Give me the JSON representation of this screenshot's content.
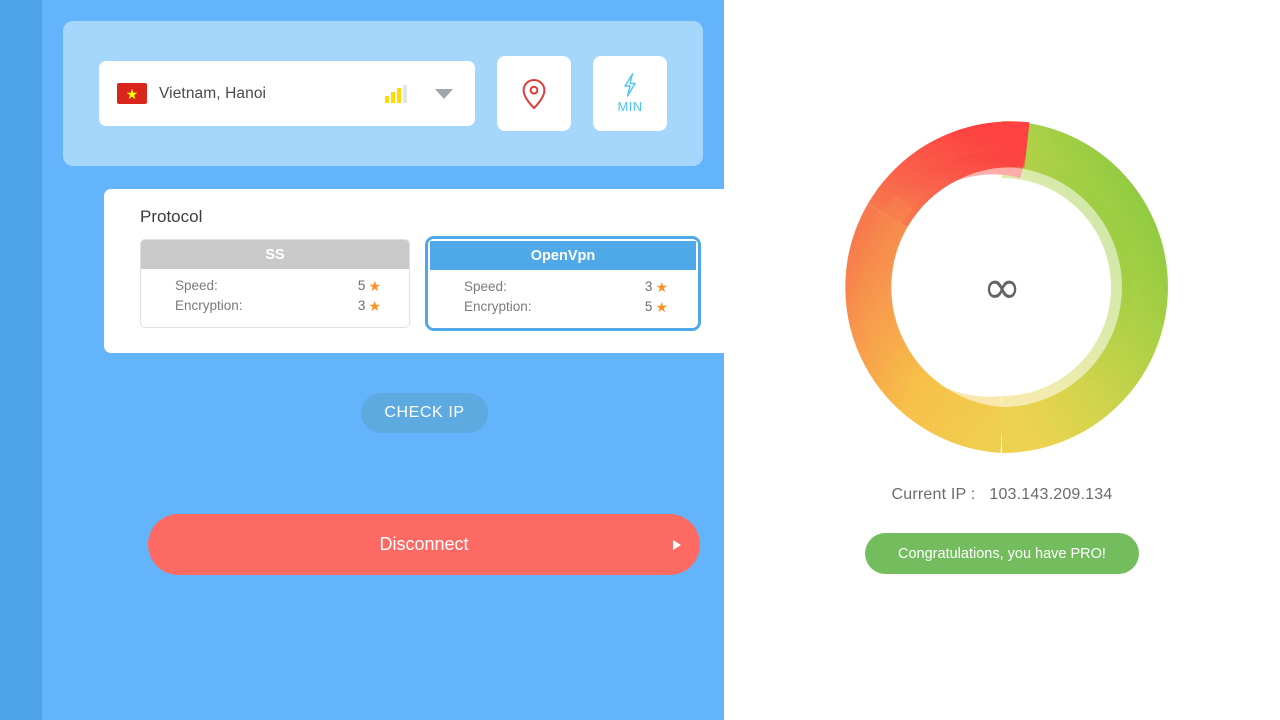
{
  "theme": {
    "edge_strip": "#4ea3e8",
    "panel_bg": "#63b4fb",
    "server_card_bg": "#a5d6fc",
    "accent_blue": "#4fa9e8",
    "disconnect_red": "#fc6a63",
    "pro_green": "#74bd5e",
    "star_orange": "#ff9026",
    "pin_red": "#e03b3b",
    "min_cyan": "#4ec3f7",
    "right_panel_bg": "#ffffff"
  },
  "server": {
    "flag_icon": "vietnam-flag-icon",
    "name": "Vietnam, Hanoi",
    "signal_icon": "signal-bars-icon",
    "signal_bars_active": 3,
    "signal_bars_total": 4,
    "dropdown_icon": "chevron-down-icon",
    "location_icon": "location-pin-icon",
    "speed_icon": "lightning-bolt-icon",
    "speed_label": "MIN"
  },
  "protocol": {
    "title": "Protocol",
    "options": [
      {
        "name": "SS",
        "selected": false,
        "speed_label": "Speed:",
        "speed_value": "5",
        "encryption_label": "Encryption:",
        "encryption_value": "3",
        "star_icon": "star-icon"
      },
      {
        "name": "OpenVpn",
        "selected": true,
        "speed_label": "Speed:",
        "speed_value": "3",
        "encryption_label": "Encryption:",
        "encryption_value": "5",
        "star_icon": "star-icon"
      }
    ]
  },
  "actions": {
    "check_ip_label": "CHECK IP",
    "disconnect_label": "Disconnect",
    "disconnect_arrow_icon": "play-arrow-icon"
  },
  "status": {
    "gauge_center_symbol": "∞",
    "gauge_meaning": "unlimited-data",
    "ip_label": "Current IP :",
    "ip_value": "103.143.209.134",
    "pro_badge_label": "Congratulations, you have PRO!"
  },
  "chart_data": {
    "type": "pie",
    "title": "Data usage gauge",
    "center_label": "∞",
    "outer_ring": {
      "sweep_degrees": 360,
      "start_angle_deg": 10,
      "gradient_stops": [
        {
          "position": 0.0,
          "color": "#86c840"
        },
        {
          "position": 0.22,
          "color": "#aed14a"
        },
        {
          "position": 0.42,
          "color": "#dbd64f"
        },
        {
          "position": 0.58,
          "color": "#f6c44a"
        },
        {
          "position": 0.74,
          "color": "#f79a4c"
        },
        {
          "position": 0.9,
          "color": "#f76a4e"
        },
        {
          "position": 1.0,
          "color": "#fb4a44"
        }
      ]
    },
    "inner_ring": {
      "sweep_degrees": 360,
      "opacity": 0.5,
      "note": "lighter translucent band inset inside the outer ring"
    },
    "segments": [
      {
        "name": "green",
        "from_deg": 10,
        "to_deg": 130,
        "color": "#86c840"
      },
      {
        "name": "yellow",
        "from_deg": 130,
        "to_deg": 230,
        "color": "#dbd64f"
      },
      {
        "name": "orange",
        "from_deg": 230,
        "to_deg": 320,
        "color": "#f79a4c"
      },
      {
        "name": "red",
        "from_deg": 320,
        "to_deg": 370,
        "color": "#fb4a44"
      }
    ]
  }
}
